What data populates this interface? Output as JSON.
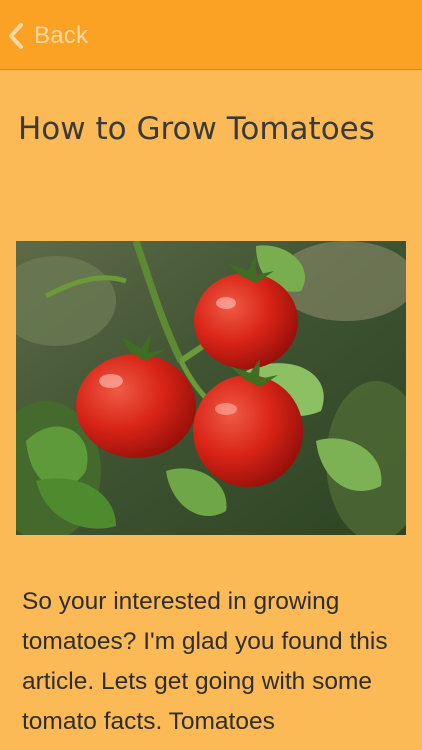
{
  "header": {
    "back_label": "Back",
    "back_icon": "chevron-left-icon"
  },
  "page": {
    "title": "How to Grow Tomatoes",
    "hero_image": "tomatoes-on-vine-photo",
    "body_text": "So your interested in growing tomatoes? I'm glad you found this article. Lets get going with some tomato facts. Tomatoes"
  },
  "colors": {
    "background": "#FBBA56",
    "topbar": "#FBA124",
    "back_text": "#FCD9A3",
    "title_text": "#3A3A3A",
    "body_text": "#2E2E2E"
  }
}
